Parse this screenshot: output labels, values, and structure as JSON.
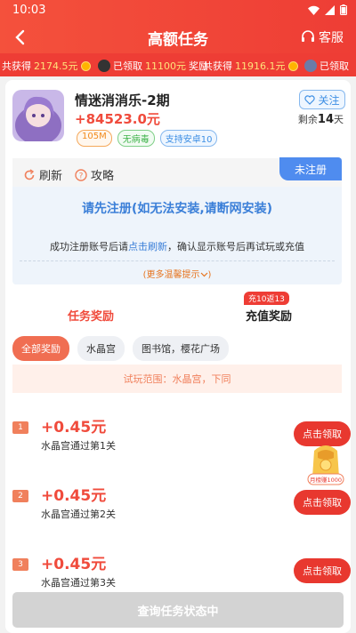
{
  "status_bar": {
    "time": "10:03"
  },
  "nav": {
    "title": "高额任务",
    "service": "客服"
  },
  "ticker": [
    {
      "prefix": "共获得",
      "amount": "2174.5元",
      "suffix": ""
    },
    {
      "prefix": "已领取",
      "amount": "11100元",
      "suffix": "奖励"
    },
    {
      "prefix": "共获得",
      "amount": "11916.1元",
      "suffix": ""
    },
    {
      "prefix": "已领取",
      "amount": "",
      "suffix": ""
    }
  ],
  "game": {
    "name": "情迷消消乐-2期",
    "reward": "+84523.0元",
    "tags": [
      "105M",
      "无病毒",
      "支持安卓10"
    ],
    "follow": "关注",
    "remain_prefix": "剩余",
    "remain_days": "14",
    "remain_suffix": "天"
  },
  "register": {
    "refresh": "刷新",
    "guide": "攻略",
    "flag": "未注册",
    "main": "请先注册(如无法安装,请断网安装)",
    "sub_pre": "成功注册账号后请",
    "sub_link": "点击刷新",
    "sub_post": "，确认显示账号后再试玩或充值",
    "more": "(更多温馨提示"
  },
  "tabs": {
    "task": "任务奖励",
    "recharge": "充值奖励",
    "badge": "充10返13"
  },
  "chips": [
    "全部奖励",
    "水晶宫",
    "图书馆，樱花广场"
  ],
  "range": "试玩范围：水晶宫，下同",
  "tasks": [
    {
      "num": "1",
      "amount": "+0.45元",
      "desc": "水晶宫通过第1关",
      "btn": "点击领取"
    },
    {
      "num": "2",
      "amount": "+0.45元",
      "desc": "水晶宫通过第2关",
      "btn": "点击领取"
    },
    {
      "num": "3",
      "amount": "+0.45元",
      "desc": "水晶宫通过第3关",
      "btn": "点击领取"
    }
  ],
  "float_gift": {
    "label": "月榜赚1000"
  },
  "query_button": "查询任务状态中",
  "colors": {
    "primary_red": "#ee3d35",
    "accent_blue": "#3e8fe4",
    "orange": "#f0805c"
  }
}
